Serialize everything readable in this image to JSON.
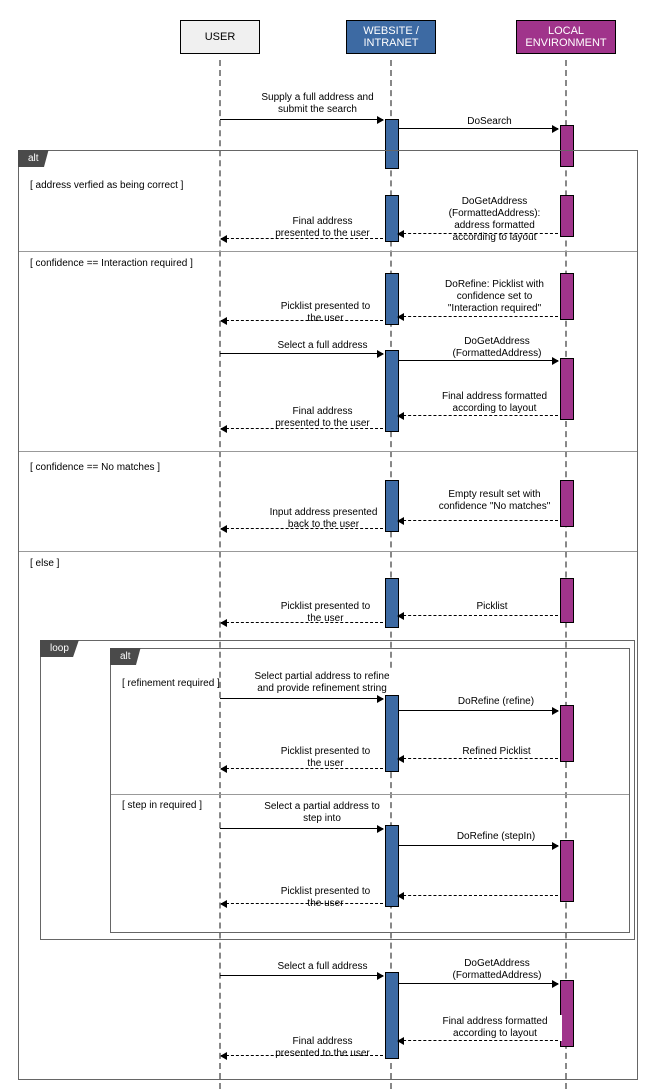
{
  "actors": {
    "user": "USER",
    "web": "WEBSITE / INTRANET",
    "local": "LOCAL ENVIRONMENT"
  },
  "frames": {
    "alt1": "alt",
    "loop": "loop",
    "alt2": "alt"
  },
  "guards": {
    "g1": "[ address verfied as being correct ]",
    "g2": "[ confidence == Interaction required ]",
    "g3": "[ confidence == No matches ]",
    "g4": "[ else ]",
    "g5": "[ refinement required ]",
    "g6": "[ step in required ]"
  },
  "msgs": {
    "m1": "Supply a full address and submit the search",
    "m2": "DoSearch",
    "m3": "DoGetAddress (FormattedAddress): address formatted according to layout",
    "m4": "Final address presented to the user",
    "m5": "DoRefine: Picklist with confidence set to \"Interaction required\"",
    "m6": "Picklist presented to the user",
    "m7": "Select a full address",
    "m8": "DoGetAddress (FormattedAddress)",
    "m9": "Final address formatted according to layout",
    "m10": "Final address presented to the user",
    "m11": "Empty result set with confidence \"No matches\"",
    "m12": "Input address presented back to the user",
    "m13": "Picklist presented to the user",
    "m14": "Picklist",
    "m15": "Select partial address to refine and provide refinement string",
    "m16": "DoRefine (refine)",
    "m17": "Picklist presented to the user",
    "m18": "Refined Picklist",
    "m19": "Select a partial address to step into",
    "m20": "DoRefine (stepIn)",
    "m21": "Picklist presented to the user",
    "m22": "Select a full address",
    "m23": "DoGetAddress (FormattedAddress)",
    "m24": "Final address formatted according to layout",
    "m25": "Final address presented to the user"
  }
}
